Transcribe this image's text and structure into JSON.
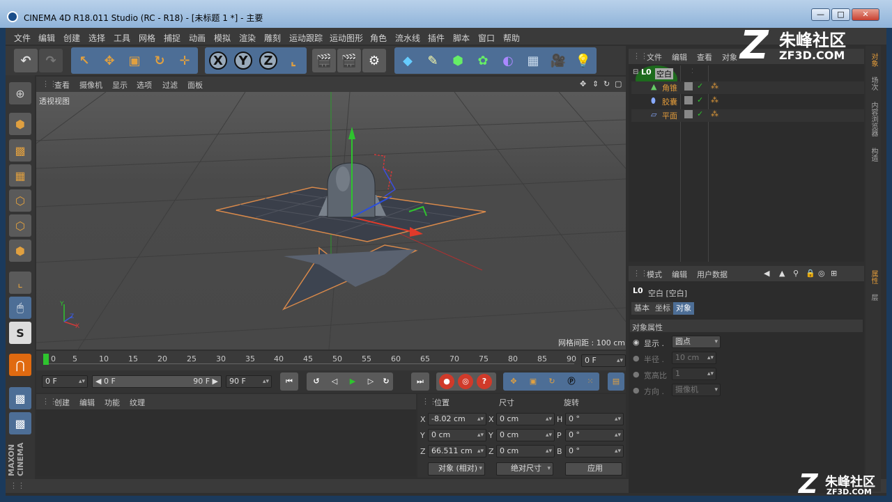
{
  "window": {
    "title": "CINEMA 4D R18.011 Studio (RC - R18) - [未标题 1 *] - 主要",
    "min": "—",
    "max": "□",
    "close": "✕"
  },
  "menubar": [
    "文件",
    "编辑",
    "创建",
    "选择",
    "工具",
    "网格",
    "捕捉",
    "动画",
    "模拟",
    "渲染",
    "雕刻",
    "运动跟踪",
    "运动图形",
    "角色",
    "流水线",
    "插件",
    "脚本",
    "窗口",
    "帮助"
  ],
  "toolbar": {
    "x": "X",
    "y": "Y",
    "z": "Z"
  },
  "viewport": {
    "menus": [
      "查看",
      "摄像机",
      "显示",
      "选项",
      "过滤",
      "面板"
    ],
    "label": "透视视图",
    "grid_info": "网格间距 : 100 cm",
    "axis_x": "X",
    "axis_y": "Y",
    "axis_z": "Z"
  },
  "timeline": {
    "ticks": [
      "0",
      "5",
      "10",
      "15",
      "20",
      "25",
      "30",
      "35",
      "40",
      "45",
      "50",
      "55",
      "60",
      "65",
      "70",
      "75",
      "80",
      "85",
      "90"
    ],
    "current": "0 F"
  },
  "transport": {
    "start": "0 F",
    "range_start": "◀ 0 F",
    "range_end": "90 F ▶",
    "end": "90 F"
  },
  "material": {
    "menus": [
      "创建",
      "编辑",
      "功能",
      "纹理"
    ]
  },
  "coords": {
    "headers": {
      "pos": "位置",
      "size": "尺寸",
      "rot": "旋转"
    },
    "rows": [
      {
        "axis": "X",
        "pos": "-8.02 cm",
        "saxis": "X",
        "size": "0 cm",
        "raxis": "H",
        "rot": "0 °"
      },
      {
        "axis": "Y",
        "pos": "0 cm",
        "saxis": "Y",
        "size": "0 cm",
        "raxis": "P",
        "rot": "0 °"
      },
      {
        "axis": "Z",
        "pos": "66.511 cm",
        "saxis": "Z",
        "size": "0 cm",
        "raxis": "B",
        "rot": "0 °"
      }
    ],
    "mode": "对象 (相对)",
    "size_mode": "绝对尺寸",
    "apply": "应用"
  },
  "objects": {
    "menus": [
      "文件",
      "编辑",
      "查看",
      "对象"
    ],
    "items": [
      {
        "name": "空白",
        "icon": "null-icon"
      },
      {
        "name": "角锥",
        "icon": "pyramid-icon"
      },
      {
        "name": "胶囊",
        "icon": "capsule-icon"
      },
      {
        "name": "平面",
        "icon": "plane-icon"
      }
    ]
  },
  "attributes": {
    "menus": [
      "模式",
      "编辑",
      "用户数据"
    ],
    "title": "空白 [空白]",
    "tabs": [
      "基本",
      "坐标",
      "对象"
    ],
    "section": "对象属性",
    "fields": [
      {
        "label": "显示 .",
        "value": "圆点"
      },
      {
        "label": "半径 .",
        "value": "10 cm"
      },
      {
        "label": "宽高比",
        "value": "1"
      },
      {
        "label": "方向 .",
        "value": "摄像机"
      }
    ]
  },
  "sidetabs": [
    "对象",
    "场次",
    "内容浏览器",
    "构造"
  ],
  "sidetabs2": [
    "属性",
    "层"
  ],
  "lefttools": {
    "s_label": "S"
  },
  "brand": "MAXON CINEMA",
  "watermark": {
    "top": "朱峰社区",
    "top_sub": "ZF3D.COM",
    "bottom": "朱峰社区",
    "bottom_sub": "ZF3D.COM"
  },
  "colors": {
    "accent": "#4d6e96",
    "selection": "#e8a04a",
    "object_orange": "#e09a3a"
  }
}
